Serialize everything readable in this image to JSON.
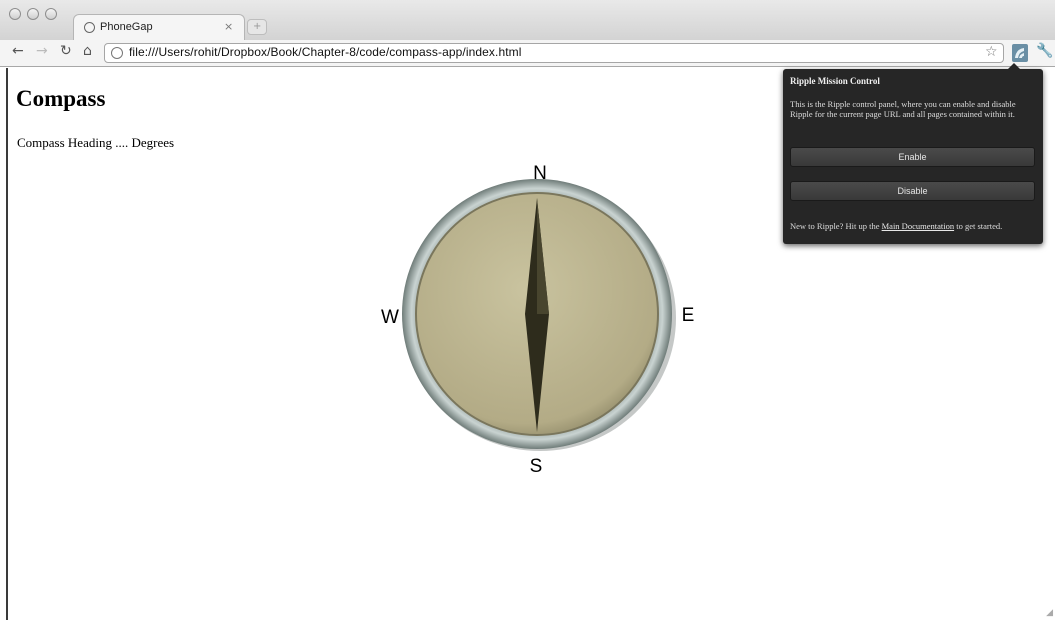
{
  "browser": {
    "tab_title": "PhoneGap",
    "tab_close_glyph": "×",
    "url": "file:///Users/rohit/Dropbox/Book/Chapter-8/code/compass-app/index.html",
    "icons": [
      "back-icon",
      "forward-icon",
      "reload-icon",
      "home-icon",
      "page-icon",
      "bookmark-star-icon",
      "ripple-extension-icon",
      "wrench-icon"
    ]
  },
  "page": {
    "title": "Compass",
    "heading_text": "Compass Heading .... Degrees"
  },
  "compass": {
    "north": "N",
    "south": "S",
    "east": "E",
    "west": "W",
    "colors": {
      "face": "#b7b08c",
      "rim": "#9aa8a4",
      "needle": "#2e2c1c"
    }
  },
  "ripple_popup": {
    "title": "Ripple Mission Control",
    "description": "This is the Ripple control panel, where you can enable and disable Ripple for the current page URL and all pages contained within it.",
    "enable_label": "Enable",
    "disable_label": "Disable",
    "footer_prefix": "New to Ripple? Hit up the ",
    "footer_link": "Main Documentation",
    "footer_suffix": " to get started."
  }
}
